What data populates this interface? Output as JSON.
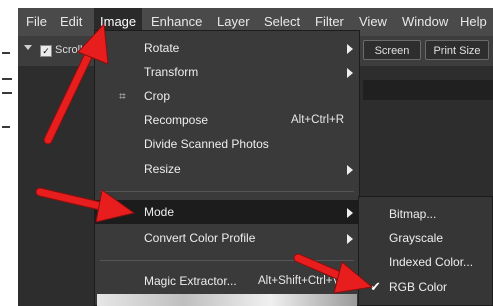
{
  "menubar": {
    "items": [
      "File",
      "Edit",
      "Image",
      "Enhance",
      "Layer",
      "Select",
      "Filter",
      "View",
      "Window",
      "Help"
    ],
    "active_index": 2
  },
  "options_bar": {
    "scroll_label": "Scroll",
    "screen_button": "Screen",
    "print_size_button": "Print Size"
  },
  "image_menu": {
    "items": [
      {
        "label": "Rotate",
        "submenu": true
      },
      {
        "label": "Transform",
        "submenu": true
      },
      {
        "label": "Crop",
        "icon": "crop-icon"
      },
      {
        "label": "Recompose",
        "shortcut": "Alt+Ctrl+R"
      },
      {
        "label": "Divide Scanned Photos"
      },
      {
        "label": "Resize",
        "submenu": true
      },
      {
        "label": "Mode",
        "submenu": true,
        "highlighted": true
      },
      {
        "label": "Convert Color Profile",
        "submenu": true
      },
      {
        "label": "Magic Extractor...",
        "shortcut": "Alt+Shift+Ctrl+V"
      }
    ]
  },
  "mode_submenu": {
    "items": [
      {
        "label": "Bitmap..."
      },
      {
        "label": "Grayscale"
      },
      {
        "label": "Indexed Color..."
      },
      {
        "label": "RGB Color",
        "checked": true
      }
    ]
  },
  "colors": {
    "menubar_bg": "#4a4a4a",
    "menu_bg": "#3a3a3a",
    "highlight_bg": "#1c1c1c",
    "annotation_arrow": "#e81e1e"
  }
}
